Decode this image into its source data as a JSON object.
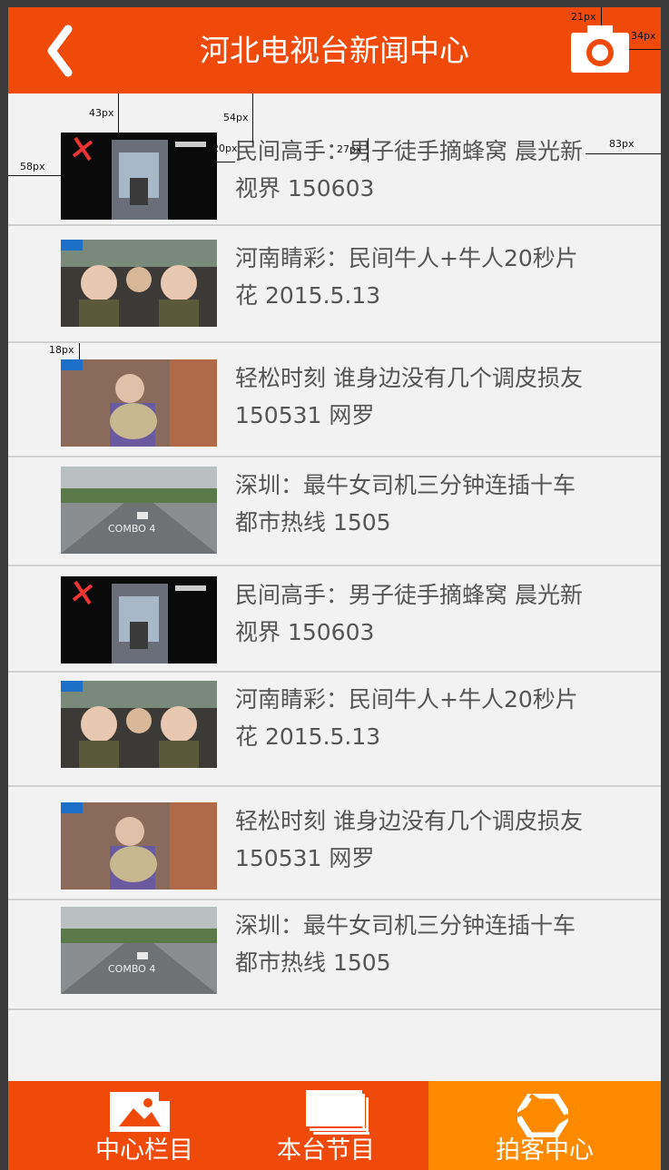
{
  "header": {
    "title": "河北电视台新闻中心",
    "back_icon": "chevron-left-icon",
    "camera_icon": "camera-icon"
  },
  "colors": {
    "primary": "#f04a0a",
    "active_tab": "#ff8a00",
    "background": "#f2f2f2",
    "divider": "#d0d0d0",
    "text": "#555555"
  },
  "news": [
    {
      "title": "民间高手：男子徒手摘蜂窝 晨光新视界 150603",
      "thumb": "thumb-a"
    },
    {
      "title": "河南睛彩：民间牛人+牛人20秒片花 2015.5.13",
      "thumb": "thumb-b"
    },
    {
      "title": "轻松时刻 谁身边没有几个调皮损友 150531 网罗",
      "thumb": "thumb-c"
    },
    {
      "title": "深圳：最牛女司机三分钟连插十车 都市热线 1505",
      "thumb": "thumb-d"
    },
    {
      "title": "民间高手：男子徒手摘蜂窝 晨光新视界 150603",
      "thumb": "thumb-a"
    },
    {
      "title": "河南睛彩：民间牛人+牛人20秒片花 2015.5.13",
      "thumb": "thumb-b"
    },
    {
      "title": "轻松时刻 谁身边没有几个调皮损友 150531 网罗",
      "thumb": "thumb-c"
    },
    {
      "title": "深圳：最牛女司机三分钟连插十车 都市热线 1505",
      "thumb": "thumb-d"
    }
  ],
  "thumb_texts": {
    "combo": "COMBO 4"
  },
  "annotations": {
    "a1": "21px",
    "a2": "34px",
    "a3": "43px",
    "a4": "54px",
    "a5": "20px",
    "a6": "27px",
    "a7": "83px",
    "a8": "58px",
    "a9": "18px"
  },
  "tabs": [
    {
      "label": "中心栏目",
      "icon": "image-icon",
      "active": false
    },
    {
      "label": "本台节目",
      "icon": "stack-icon",
      "active": false
    },
    {
      "label": "拍客中心",
      "icon": "aperture-icon",
      "active": true
    }
  ]
}
